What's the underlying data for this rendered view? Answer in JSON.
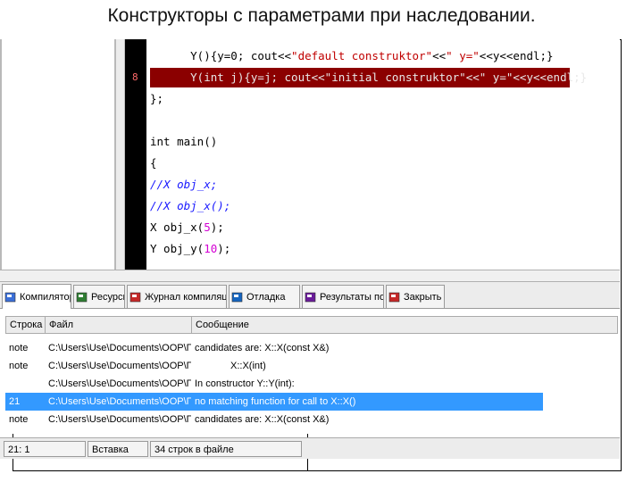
{
  "slide": {
    "title": "Конструкторы с параметрами при наследовании."
  },
  "editor": {
    "lines": [
      {
        "indent": "      ",
        "parts": [
          {
            "t": "Y(){y=0; cout<<",
            "c": "kw"
          },
          {
            "t": "\"default construktor\"",
            "c": "str"
          },
          {
            "t": "<<",
            "c": "kw"
          },
          {
            "t": "\" y=\"",
            "c": "str"
          },
          {
            "t": "<<y<<endl;}",
            "c": "kw"
          }
        ]
      },
      {
        "indent": "      ",
        "highlight": true,
        "marker": "8",
        "parts": [
          {
            "t": "Y(int j){y=j; cout<<\"initial construktor\"<<\" y=\"<<y<<endl;}",
            "c": "kw"
          }
        ]
      },
      {
        "parts": [
          {
            "t": "};",
            "c": "kw"
          }
        ]
      },
      {
        "parts": []
      },
      {
        "parts": [
          {
            "t": "int main()",
            "c": "kw"
          }
        ]
      },
      {
        "parts": [
          {
            "t": "{",
            "c": "kw"
          }
        ]
      },
      {
        "parts": [
          {
            "t": "//X obj_x;",
            "c": "com"
          }
        ]
      },
      {
        "parts": [
          {
            "t": "//X obj_x();",
            "c": "com"
          }
        ]
      },
      {
        "parts": [
          {
            "t": "X obj_x(",
            "c": "kw"
          },
          {
            "t": "5",
            "c": "num"
          },
          {
            "t": ");",
            "c": "kw"
          }
        ]
      },
      {
        "parts": [
          {
            "t": "Y obj_y(",
            "c": "kw"
          },
          {
            "t": "10",
            "c": "num"
          },
          {
            "t": ");",
            "c": "kw"
          }
        ]
      }
    ]
  },
  "tabs": [
    {
      "label": "Компилятор",
      "icon": "compiler-icon",
      "color": "#3a6fd8"
    },
    {
      "label": "Ресурсы",
      "icon": "resources-icon",
      "color": "#2e7d32"
    },
    {
      "label": "Журнал компиляции",
      "icon": "compile-log-icon",
      "color": "#c62828"
    },
    {
      "label": "Отладка",
      "icon": "debug-icon",
      "color": "#1565c0"
    },
    {
      "label": "Результаты поиска",
      "icon": "search-results-icon",
      "color": "#6a1b9a"
    },
    {
      "label": "Закрыть",
      "icon": "close-icon",
      "color": "#c62828"
    }
  ],
  "grid": {
    "columns": [
      "Строка",
      "Файл",
      "Сообщение"
    ],
    "rows": [
      {
        "line": "note",
        "file": "C:\\Users\\Use\\Documents\\OOP\\Пр...",
        "message": "candidates are: X::X(const X&)",
        "selected": false
      },
      {
        "line": "note",
        "file": "C:\\Users\\Use\\Documents\\OOP\\Пр...",
        "message": "X::X(int)",
        "indent": true,
        "selected": false
      },
      {
        "line": "",
        "file": "C:\\Users\\Use\\Documents\\OOP\\Пр...",
        "message": "In constructor Y::Y(int):",
        "selected": false
      },
      {
        "line": "21",
        "file": "C:\\Users\\Use\\Documents\\OOP\\Пр...",
        "message": "no matching function for call to X::X()",
        "selected": true
      },
      {
        "line": "note",
        "file": "C:\\Users\\Use\\Documents\\OOP\\Пр...",
        "message": "candidates are: X::X(const X&)",
        "selected": false
      }
    ]
  },
  "status": {
    "position": "21: 1",
    "mode": "Вставка",
    "lines": "34 строк в файле"
  },
  "colors": {
    "highlight_line": "#8b0000",
    "selection": "#3399ff",
    "gutter": "#000000"
  }
}
